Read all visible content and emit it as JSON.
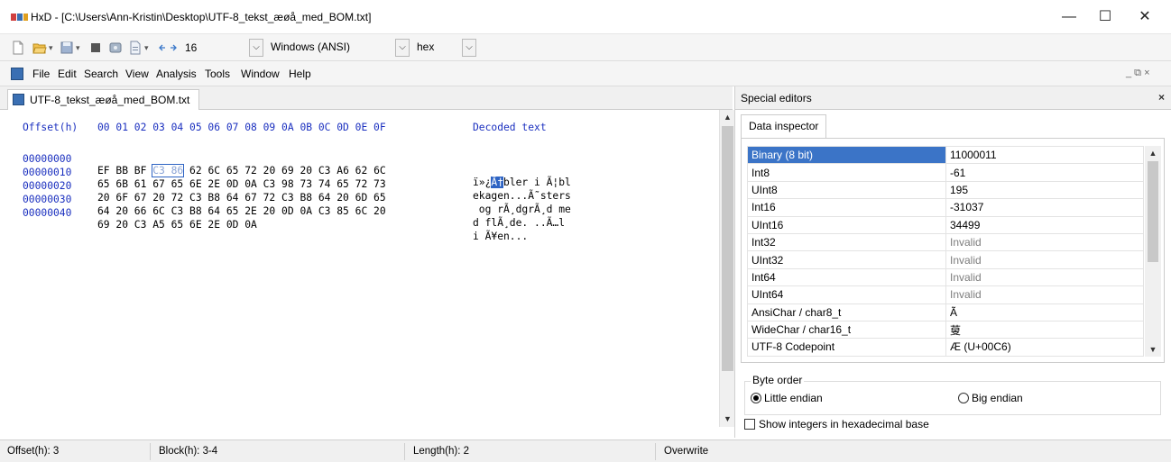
{
  "window": {
    "title": "HxD - [C:\\Users\\Ann-Kristin\\Desktop\\UTF-8_tekst_æøå_med_BOM.txt]",
    "app_icon_text": "HxD",
    "minimize_label": "—",
    "maximize_label": "☐",
    "close_label": "✕"
  },
  "toolbar": {
    "bytes_per_row": "16",
    "encoding": "Windows (ANSI)",
    "view_mode": "hex"
  },
  "menu": {
    "items": [
      "File",
      "Edit",
      "Search",
      "View",
      "Analysis",
      "Tools",
      "Window",
      "Help"
    ],
    "mdi_controls": "_ ⧉ ×"
  },
  "document_tab": {
    "label": "UTF-8_tekst_æøå_med_BOM.txt"
  },
  "hex_editor": {
    "header_offset": "Offset(h)",
    "header_columns": "00 01 02 03 04 05 06 07 08 09 0A 0B 0C 0D 0E 0F",
    "header_decoded": "Decoded text",
    "rows": [
      {
        "offset": "00000000",
        "bytes_pre": "EF BB BF ",
        "bytes_sel": "C3 86",
        "bytes_post": " 62 6C 65 72 20 69 20 C3 A6 62 6C",
        "dec_pre": "ï»¿",
        "dec_sel": "Ã†",
        "dec_post": "bler i Ã¦bl"
      },
      {
        "offset": "00000010",
        "bytes_pre": "65 6B 61 67 65 6E 2E 0D 0A C3 98 73 74 65 72 73",
        "bytes_sel": "",
        "bytes_post": "",
        "dec_pre": "ekagen...Ã˜sters",
        "dec_sel": "",
        "dec_post": ""
      },
      {
        "offset": "00000020",
        "bytes_pre": "20 6F 67 20 72 C3 B8 64 67 72 C3 B8 64 20 6D 65",
        "bytes_sel": "",
        "bytes_post": "",
        "dec_pre": " og rÃ¸dgrÃ¸d me",
        "dec_sel": "",
        "dec_post": ""
      },
      {
        "offset": "00000030",
        "bytes_pre": "64 20 66 6C C3 B8 64 65 2E 20 0D 0A C3 85 6C 20",
        "bytes_sel": "",
        "bytes_post": "",
        "dec_pre": "d flÃ¸de. ..Ã…l ",
        "dec_sel": "",
        "dec_post": ""
      },
      {
        "offset": "00000040",
        "bytes_pre": "69 20 C3 A5 65 6E 2E 0D 0A",
        "bytes_sel": "",
        "bytes_post": "",
        "dec_pre": "i Ã¥en...",
        "dec_sel": "",
        "dec_post": ""
      }
    ]
  },
  "side_panel": {
    "title": "Special editors",
    "close_label": "×",
    "tab_label": "Data inspector",
    "inspector_rows": [
      {
        "name": "Binary (8 bit)",
        "value": "11000011",
        "invalid": false
      },
      {
        "name": "Int8",
        "value": "-61",
        "invalid": false
      },
      {
        "name": "UInt8",
        "value": "195",
        "invalid": false
      },
      {
        "name": "Int16",
        "value": "-31037",
        "invalid": false
      },
      {
        "name": "UInt16",
        "value": "34499",
        "invalid": false
      },
      {
        "name": "Int32",
        "value": "Invalid",
        "invalid": true
      },
      {
        "name": "UInt32",
        "value": "Invalid",
        "invalid": true
      },
      {
        "name": "Int64",
        "value": "Invalid",
        "invalid": true
      },
      {
        "name": "UInt64",
        "value": "Invalid",
        "invalid": true
      },
      {
        "name": "AnsiChar / char8_t",
        "value": "Ã",
        "invalid": false
      },
      {
        "name": "WideChar / char16_t",
        "value": "蓃",
        "invalid": false
      },
      {
        "name": "UTF-8 Codepoint",
        "value": "Æ (U+00C6)",
        "invalid": false
      }
    ],
    "byte_order_label": "Byte order",
    "little_endian_label": "Little endian",
    "big_endian_label": "Big endian",
    "little_endian_selected": true,
    "hex_integers_label": "Show integers in hexadecimal base",
    "hex_integers_checked": false
  },
  "status_bar": {
    "offset": "Offset(h): 3",
    "block": "Block(h): 3-4",
    "length": "Length(h): 2",
    "mode": "Overwrite"
  },
  "colors": {
    "hex_header_blue": "#1a2fbf",
    "selection_blue": "#2e64c4",
    "inspector_selected": "#3b74c7"
  }
}
